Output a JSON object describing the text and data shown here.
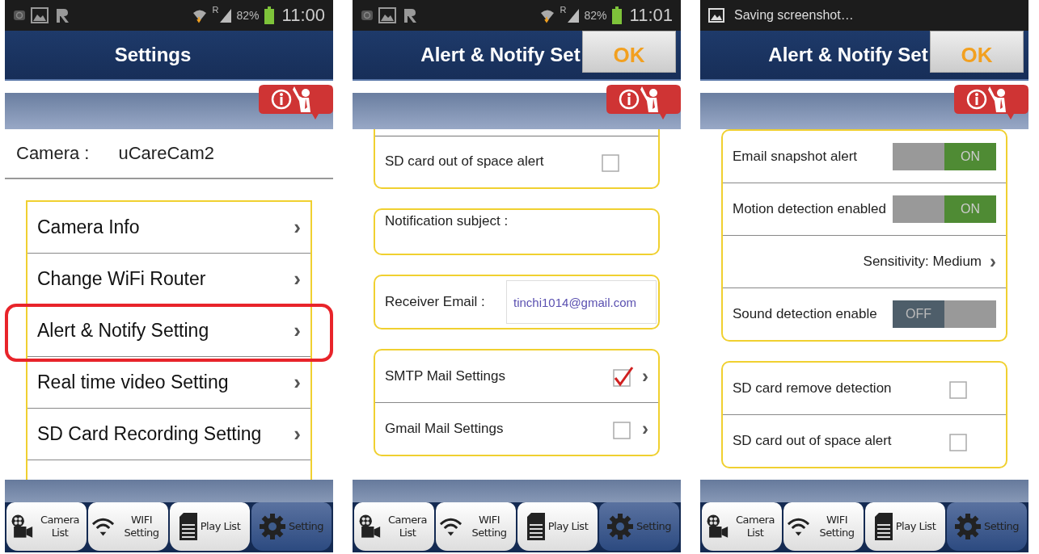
{
  "phones": [
    {
      "status": {
        "kind": "icons",
        "network": "R",
        "battery": "82%",
        "time": "11:00"
      },
      "header": {
        "title": "Settings"
      },
      "camera": {
        "label": "Camera :",
        "value": "uCareCam2"
      },
      "menu": [
        {
          "label": "Camera Info",
          "chevron": "›",
          "highlighted": false
        },
        {
          "label": "Change WiFi Router",
          "chevron": "›",
          "highlighted": false
        },
        {
          "label": "Alert & Notify Setting",
          "chevron": "›",
          "highlighted": true
        },
        {
          "label": "Real time video Setting",
          "chevron": "›",
          "highlighted": false
        },
        {
          "label": "SD Card Recording Setting",
          "chevron": "›",
          "highlighted": false
        }
      ],
      "tabs": [
        {
          "label": "Camera List",
          "selected": false
        },
        {
          "label": "WIFI Setting",
          "selected": false
        },
        {
          "label": "Play List",
          "selected": false
        },
        {
          "label": "Setting",
          "selected": true
        }
      ]
    },
    {
      "status": {
        "kind": "icons",
        "network": "R",
        "battery": "82%",
        "time": "11:01"
      },
      "header": {
        "title": "Alert & Notify Set",
        "ok": "OK"
      },
      "cards": [
        {
          "cut_top": true,
          "rows": [
            {
              "kind": "checkbox",
              "label": "SD card out of space alert",
              "checked": false
            }
          ]
        },
        {
          "cut_top": false,
          "rows": [
            {
              "kind": "field",
              "label": "Notification subject :"
            }
          ]
        },
        {
          "cut_top": false,
          "rows": [
            {
              "kind": "email",
              "label": "Receiver Email :",
              "value": "tinchi1014@gmail.com"
            }
          ]
        },
        {
          "cut_top": false,
          "rows": [
            {
              "kind": "checkbox-link",
              "label": "SMTP Mail Settings",
              "checked": true,
              "chevron": "›"
            },
            {
              "kind": "checkbox-link",
              "label": "Gmail Mail Settings",
              "checked": false,
              "chevron": "›"
            }
          ]
        }
      ],
      "tabs": [
        {
          "label": "Camera List",
          "selected": false
        },
        {
          "label": "WIFI Setting",
          "selected": false
        },
        {
          "label": "Play List",
          "selected": false
        },
        {
          "label": "Setting",
          "selected": true
        }
      ]
    },
    {
      "status": {
        "kind": "notification",
        "text": "Saving screenshot…"
      },
      "header": {
        "title": "Alert & Notify Set",
        "ok": "OK"
      },
      "cards": [
        {
          "cut_top": false,
          "rows": [
            {
              "kind": "toggle",
              "label": "Email snapshot alert",
              "on": true,
              "state_text": "ON"
            },
            {
              "kind": "toggle",
              "label": "Motion detection enabled",
              "on": true,
              "state_text": "ON"
            },
            {
              "kind": "link",
              "label": "Sensitivity: Medium",
              "chevron": "›"
            },
            {
              "kind": "toggle",
              "label": "Sound detection enable",
              "on": false,
              "state_text": "OFF"
            }
          ]
        },
        {
          "cut_top": false,
          "rows": [
            {
              "kind": "checkbox",
              "label": "SD card remove detection",
              "checked": false
            },
            {
              "kind": "checkbox",
              "label": "SD card out of space alert",
              "checked": false
            }
          ]
        }
      ],
      "tabs": [
        {
          "label": "Camera List",
          "selected": false
        },
        {
          "label": "WIFI Setting",
          "selected": false
        },
        {
          "label": "Play List",
          "selected": false
        },
        {
          "label": "Setting",
          "selected": true
        }
      ]
    }
  ]
}
